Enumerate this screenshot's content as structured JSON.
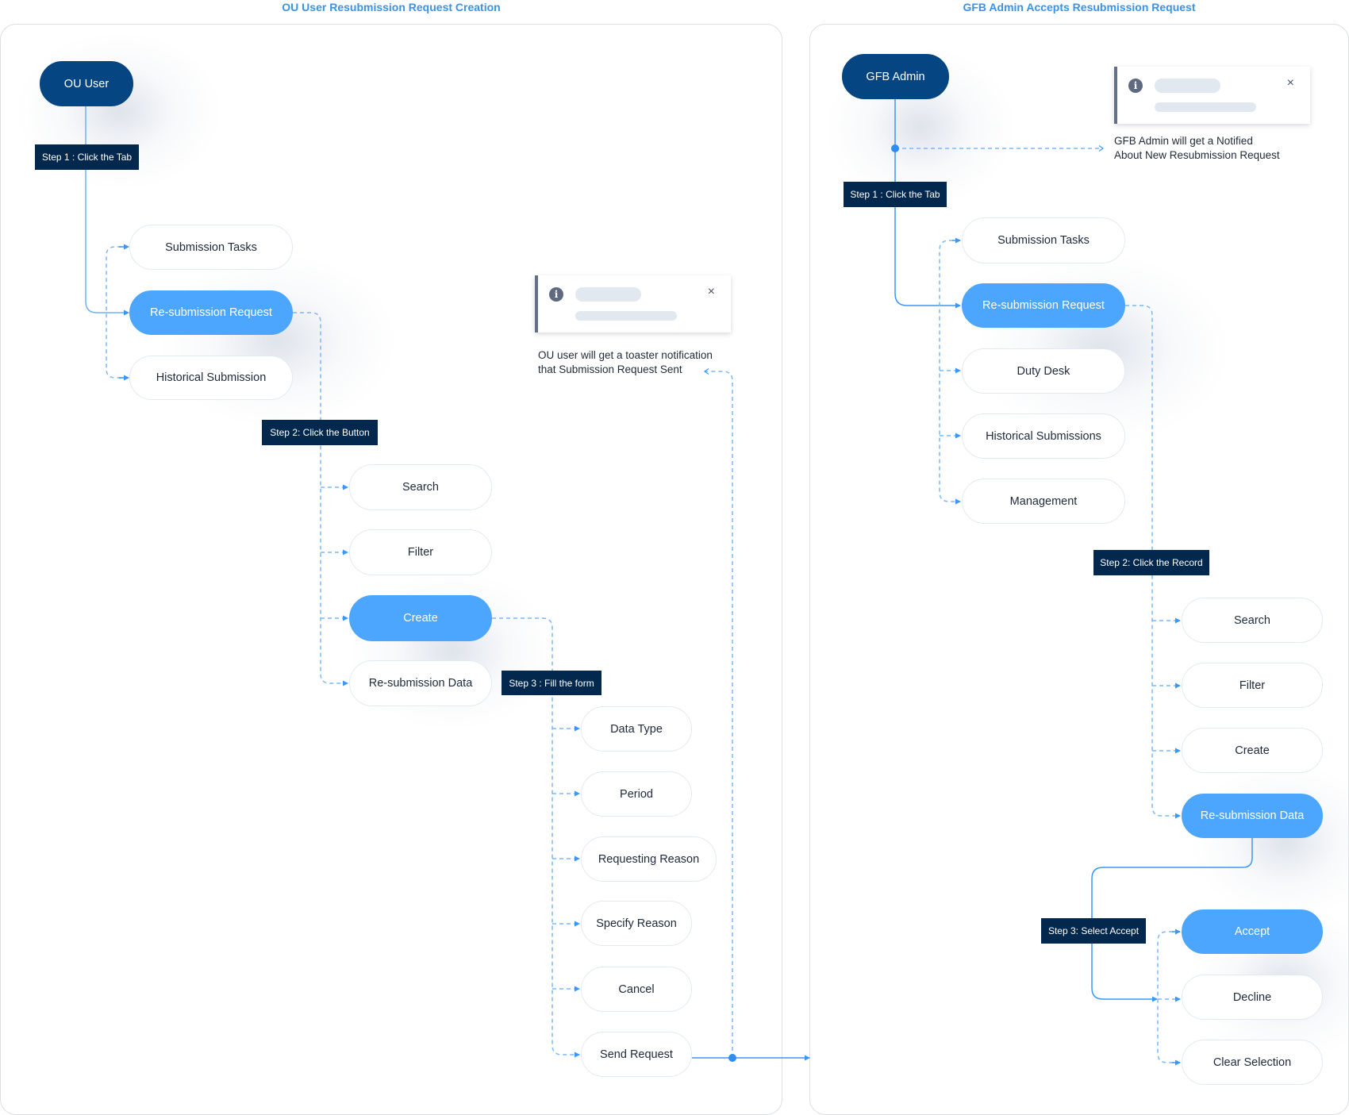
{
  "left_flow": {
    "title": "OU User Resubmission Request Creation",
    "actor": "OU User",
    "steps": {
      "step1": "Step 1 : Click the Tab",
      "step2": "Step 2: Click the Button",
      "step3": "Step 3 : Fill the form"
    },
    "tabs": [
      "Submission Tasks",
      "Re-submission Request",
      "Historical Submission"
    ],
    "active_tab": "Re-submission Request",
    "buttons": [
      "Search",
      "Filter",
      "Create",
      "Re-submission Data"
    ],
    "active_button": "Create",
    "form_fields": [
      "Data Type",
      "Period",
      "Requesting Reason",
      "Specify Reason",
      "Cancel",
      "Send Request"
    ],
    "toast": {
      "icon": "info-icon",
      "close_icon": "close-icon",
      "info_glyph": "i",
      "close_glyph": "×"
    },
    "note_lines": [
      "OU user will get a toaster notification",
      "that Submission Request Sent"
    ]
  },
  "right_flow": {
    "title": "GFB Admin  Accepts Resubmission Request",
    "actor": "GFB Admin",
    "steps": {
      "step1": "Step 1 : Click the Tab",
      "step2": "Step 2: Click the Record",
      "step3": "Step 3: Select Accept"
    },
    "tabs": [
      "Submission Tasks",
      "Re-submission Request",
      "Duty Desk",
      "Historical Submissions",
      "Management"
    ],
    "active_tab": "Re-submission Request",
    "buttons": [
      "Search",
      "Filter",
      "Create",
      "Re-submission Data"
    ],
    "active_button": "Re-submission Data",
    "actions": [
      "Accept",
      "Decline",
      "Clear Selection"
    ],
    "active_action": "Accept",
    "toast": {
      "icon": "info-icon",
      "close_icon": "close-icon",
      "info_glyph": "i",
      "close_glyph": "×"
    },
    "note_lines": [
      "GFB Admin will get a Notified",
      "About New Resubmission Request"
    ]
  },
  "colors": {
    "accent_blue": "#4da6fd",
    "actor_navy": "#044582",
    "step_label_navy": "#03284d",
    "title_blue": "#3a92e4",
    "connector_blue": "#3b97f5"
  }
}
